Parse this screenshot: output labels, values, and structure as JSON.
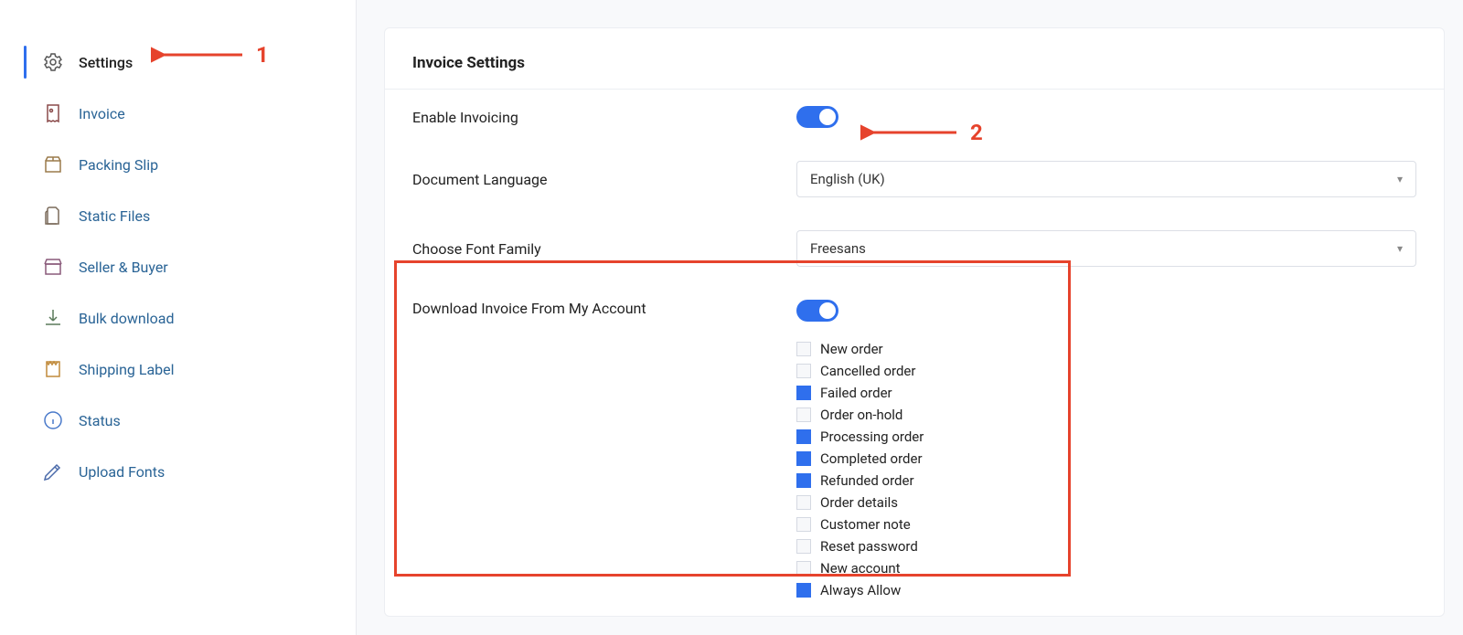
{
  "sidebar": {
    "items": [
      {
        "label": "Settings",
        "icon": "gear-icon",
        "active": true
      },
      {
        "label": "Invoice",
        "icon": "invoice-icon",
        "active": false
      },
      {
        "label": "Packing Slip",
        "icon": "box-icon",
        "active": false
      },
      {
        "label": "Static Files",
        "icon": "file-icon",
        "active": false
      },
      {
        "label": "Seller & Buyer",
        "icon": "store-icon",
        "active": false
      },
      {
        "label": "Bulk download",
        "icon": "download-icon",
        "active": false
      },
      {
        "label": "Shipping Label",
        "icon": "label-icon",
        "active": false
      },
      {
        "label": "Status",
        "icon": "info-icon",
        "active": false
      },
      {
        "label": "Upload Fonts",
        "icon": "pen-icon",
        "active": false
      }
    ]
  },
  "page": {
    "title": "Invoice Settings",
    "enable_invoicing_label": "Enable Invoicing",
    "enable_invoicing_on": true,
    "document_language_label": "Document Language",
    "document_language_value": "English (UK)",
    "font_family_label": "Choose Font Family",
    "font_family_value": "Freesans",
    "download_invoice_label": "Download Invoice From My Account",
    "download_invoice_on": true,
    "download_options": [
      {
        "label": "New order",
        "checked": false
      },
      {
        "label": "Cancelled order",
        "checked": false
      },
      {
        "label": "Failed order",
        "checked": true
      },
      {
        "label": "Order on-hold",
        "checked": false
      },
      {
        "label": "Processing order",
        "checked": true
      },
      {
        "label": "Completed order",
        "checked": true
      },
      {
        "label": "Refunded order",
        "checked": true
      },
      {
        "label": "Order details",
        "checked": false
      },
      {
        "label": "Customer note",
        "checked": false
      },
      {
        "label": "Reset password",
        "checked": false
      },
      {
        "label": "New account",
        "checked": false
      },
      {
        "label": "Always Allow",
        "checked": true
      }
    ]
  },
  "annotations": {
    "a1": "1",
    "a2": "2"
  }
}
